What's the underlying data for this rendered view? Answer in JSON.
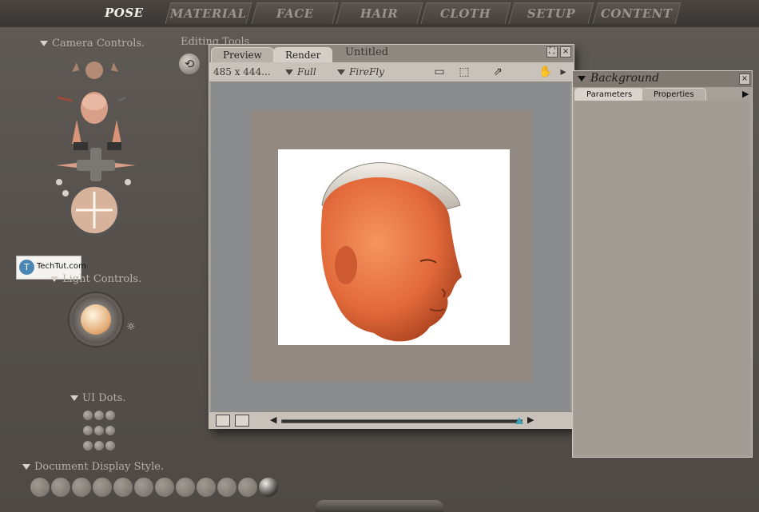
{
  "top_tabs": {
    "pose": "POSE",
    "material": "MATERIAL",
    "face": "FACE",
    "hair": "HAIR",
    "cloth": "CLOTH",
    "setup": "SETUP",
    "content": "CONTENT"
  },
  "left": {
    "camera_controls": "Camera Controls.",
    "editing_tools": "Editing Tools",
    "light_controls": "Light Controls.",
    "ui_dots": "UI Dots.",
    "document_display_style": "Document Display Style."
  },
  "watermark": {
    "text": "TechTut.com",
    "logo": "T"
  },
  "document_window": {
    "tabs": {
      "preview": "Preview",
      "render": "Render"
    },
    "title": "Untitled",
    "size_readout": "485 x 444...",
    "mode": "Full",
    "renderer": "FireFly"
  },
  "background_panel": {
    "title": "Background",
    "tabs": {
      "parameters": "Parameters",
      "properties": "Properties"
    }
  },
  "colors": {
    "render_bg": "#ffffff",
    "skin": "#e2693a",
    "active_tab_text": "#f2eee8"
  }
}
